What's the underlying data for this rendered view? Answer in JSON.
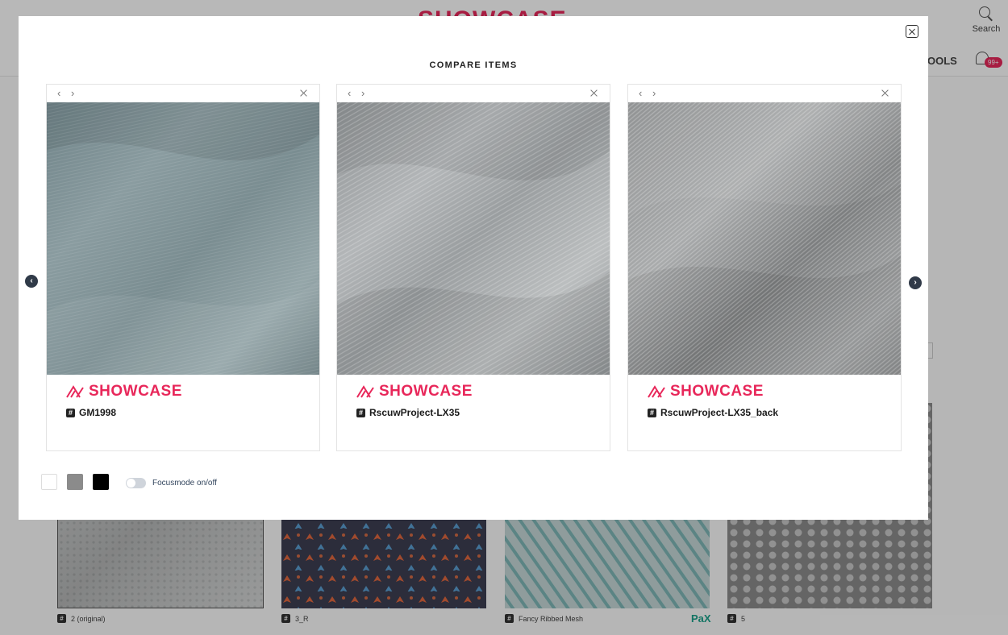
{
  "background": {
    "logo": "SHOWCASE",
    "search_label": "Search",
    "tools_label": "OOLS",
    "notifications_badge": "99+",
    "cards": [
      {
        "label": "2 (original)"
      },
      {
        "label": "3_R"
      },
      {
        "label": "Fancy Ribbed Mesh",
        "brand": "PaX"
      },
      {
        "label": "5"
      }
    ]
  },
  "modal": {
    "title": "COMPARE ITEMS",
    "close_icon": "close-icon",
    "nav_left_icon": "chevron-left-icon",
    "nav_right_icon": "chevron-right-icon",
    "items": [
      {
        "id": "GM1998",
        "brand": "SHOWCASE",
        "swatch_color": "#7b8b8f"
      },
      {
        "id": "RscuwProject-LX35",
        "brand": "SHOWCASE",
        "swatch_color": "#9a9c9e"
      },
      {
        "id": "RscuwProject-LX35_back",
        "brand": "SHOWCASE",
        "swatch_color": "#8e8f90"
      }
    ],
    "backgrounds": [
      "#ffffff",
      "#8b8b8b",
      "#000000"
    ],
    "focus_mode_label": "Focusmode on/off",
    "focus_mode_on": false
  },
  "colors": {
    "brand": "#e8275a",
    "nav_dark": "#303a48"
  }
}
